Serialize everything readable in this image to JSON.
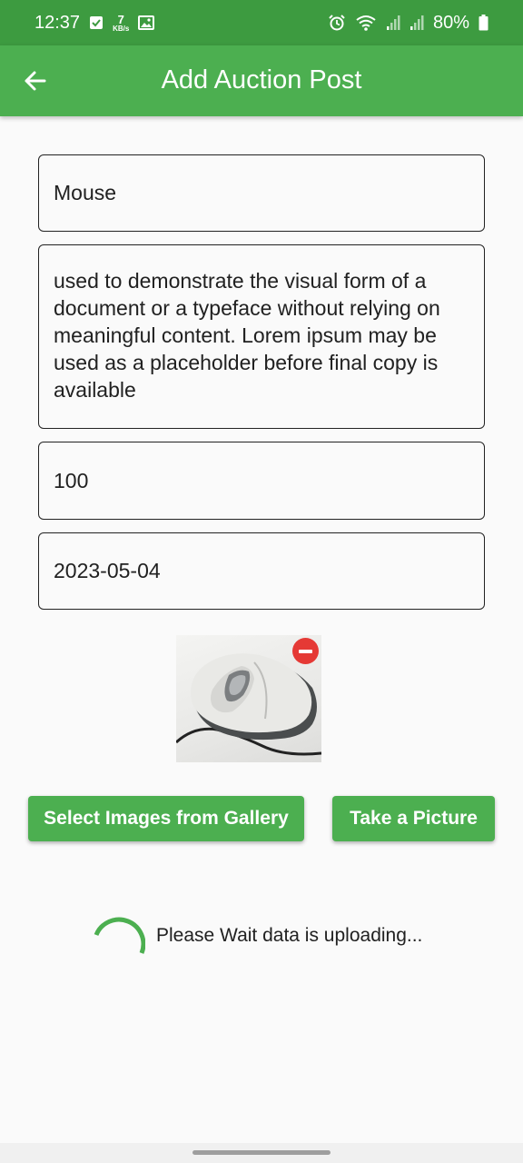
{
  "status_bar": {
    "time": "12:37",
    "data_rate_number": "7",
    "data_rate_unit": "KB/s",
    "battery": "80%"
  },
  "app_bar": {
    "title": "Add Auction Post"
  },
  "form": {
    "title_value": "Mouse",
    "description_value": "used to demonstrate the visual form of a document or a typeface without relying on meaningful content. Lorem ipsum may be used as a placeholder before final copy is available",
    "price_value": "100",
    "date_value": "2023-05-04"
  },
  "actions": {
    "gallery_label": "Select Images from Gallery",
    "camera_label": "Take a Picture"
  },
  "loading": {
    "text": "Please Wait data is uploading..."
  },
  "colors": {
    "primary": "#4caf50",
    "status_bar": "#3d9b40",
    "remove": "#e53935"
  }
}
